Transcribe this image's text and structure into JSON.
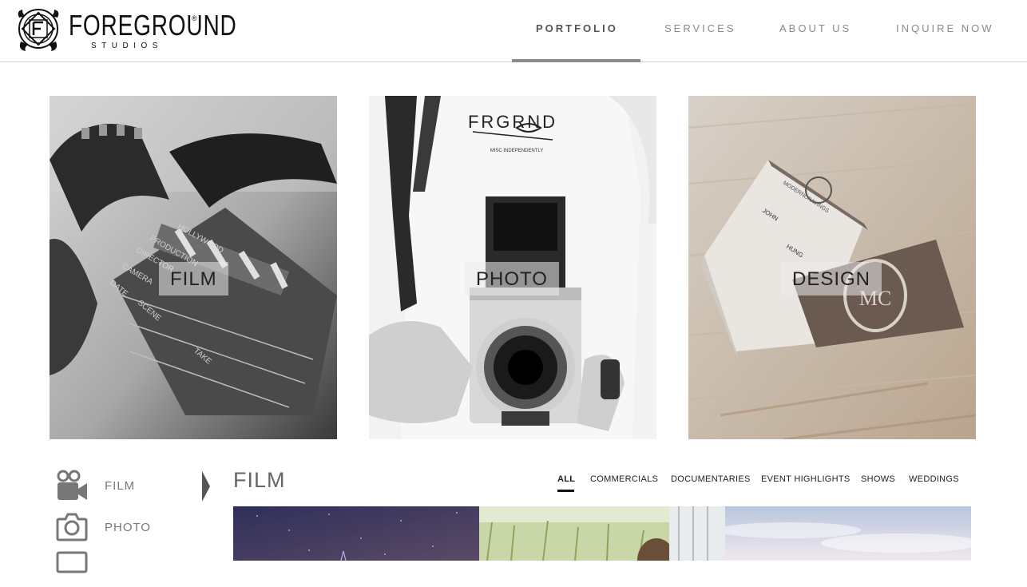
{
  "brand": {
    "name": "FOREGROUND",
    "registered": "®",
    "subtitle": "STUDIOS"
  },
  "nav": {
    "items": [
      {
        "label": "PORTFOLIO",
        "active": true
      },
      {
        "label": "SERVICES",
        "active": false
      },
      {
        "label": "ABOUT US",
        "active": false
      },
      {
        "label": "INQUIRE NOW",
        "active": false
      }
    ]
  },
  "categories": [
    {
      "label": "FILM"
    },
    {
      "label": "PHOTO"
    },
    {
      "label": "DESIGN"
    }
  ],
  "sidebar": {
    "items": [
      {
        "label": "FILM",
        "icon": "video-camera-icon"
      },
      {
        "label": "PHOTO",
        "icon": "camera-icon"
      },
      {
        "label": "",
        "icon": "monitor-icon"
      }
    ]
  },
  "section": {
    "title": "FILM",
    "filters": [
      {
        "label": "ALL",
        "active": true
      },
      {
        "label": "COMMERCIALS",
        "active": false
      },
      {
        "label": "DOCUMENTARIES",
        "active": false
      },
      {
        "label": "EVENT HIGHLIGHTS",
        "active": false
      },
      {
        "label": "SHOWS",
        "active": false
      },
      {
        "label": "WEDDINGS",
        "active": false
      }
    ]
  },
  "photo_text": {
    "shirt_print": "FRGRND",
    "shirt_tagline": "MISC INDEPENDENTLY",
    "clapper": [
      "HOLLYWOOD",
      "PRODUCTION",
      "DIRECTOR",
      "CAMERA",
      "DATE",
      "SCENE",
      "TAKE"
    ],
    "card_brand": "MODERNCRAVINGS",
    "card_names": [
      "JOHN",
      "HUNG"
    ],
    "card_monogram": "MC"
  },
  "colors": {
    "nav_active": "#555555",
    "nav_inactive": "#8a8a8a",
    "underline": "#8a8a8a"
  }
}
